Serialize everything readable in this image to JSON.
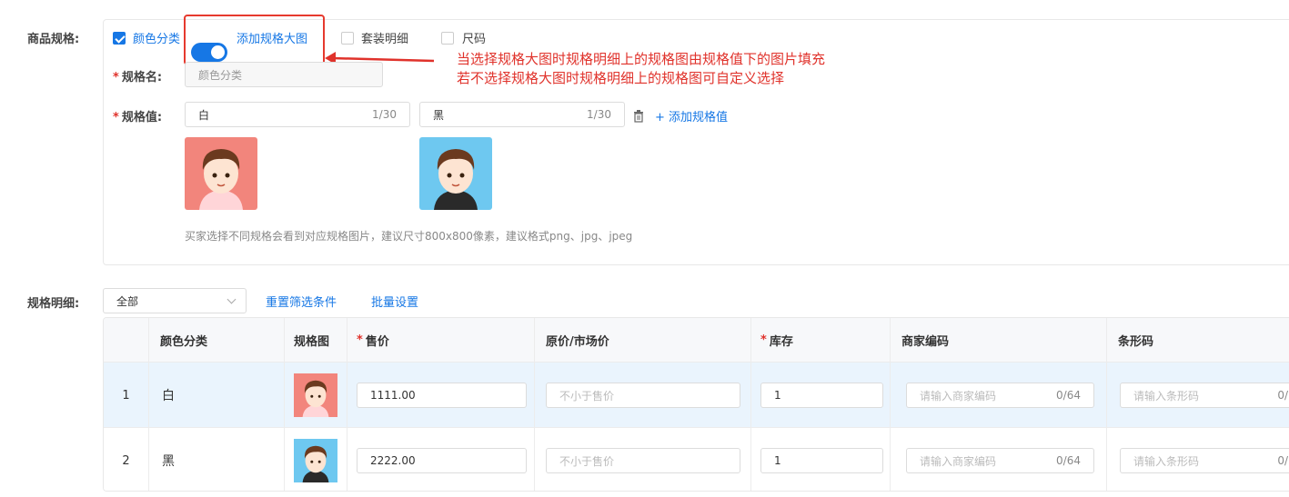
{
  "spec": {
    "label": "商品规格:",
    "options": {
      "color_class": "颜色分类",
      "big_image_toggle": "添加规格大图",
      "set_detail": "套装明细",
      "size": "尺码"
    },
    "name_label": "规格名:",
    "name_value": "颜色分类",
    "value_label": "规格值:",
    "values": [
      {
        "text": "白",
        "count": "1/30"
      },
      {
        "text": "黑",
        "count": "1/30"
      }
    ],
    "add_value": "添加规格值",
    "hint": "买家选择不同规格会看到对应规格图片，建议尺寸800x800像素，建议格式png、jpg、jpeg"
  },
  "annotation": {
    "line1": "当选择规格大图时规格明细上的规格图由规格值下的图片填充",
    "line2": "若不选择规格大图时规格明细上的规格图可自定义选择"
  },
  "detail": {
    "label": "规格明细:",
    "filter_value": "全部",
    "reset": "重置筛选条件",
    "batch": "批量设置",
    "columns": [
      "颜色分类",
      "规格图",
      "售价",
      "原价/市场价",
      "库存",
      "商家编码",
      "条形码"
    ],
    "rows": [
      {
        "index": "1",
        "color": "白",
        "price": "1111.00",
        "orig_placeholder": "不小于售价",
        "stock": "1",
        "code_placeholder": "请输入商家编码",
        "code_count": "0/64",
        "barcode_placeholder": "请输入条形码",
        "barcode_count": "0/"
      },
      {
        "index": "2",
        "color": "黑",
        "price": "2222.00",
        "orig_placeholder": "不小于售价",
        "stock": "1",
        "code_placeholder": "请输入商家编码",
        "code_count": "0/64",
        "barcode_placeholder": "请输入条形码",
        "barcode_count": "0/"
      }
    ]
  },
  "colors": {
    "accent": "#1677e5",
    "annotation": "#e0322b",
    "row_highlight": "#eaf4fd"
  }
}
